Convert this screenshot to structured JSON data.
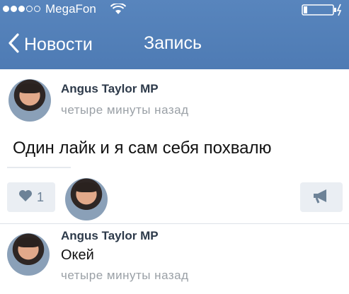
{
  "status_bar": {
    "carrier": "MegaFon",
    "signal_dots_filled": 3,
    "signal_dots_total": 5
  },
  "nav": {
    "back_label": "Новости",
    "title": "Запись"
  },
  "post": {
    "author": "Angus Taylor MP",
    "time": "четыре минуты назад",
    "text": "Один лайк и я сам себя похвалю",
    "likes_count": "1"
  },
  "comment": {
    "author": "Angus Taylor MP",
    "text": "Окей",
    "time": "четыре минуты назад"
  },
  "colors": {
    "header_blue": "#4e7bb4",
    "button_bg": "#eaeef3",
    "icon_gray": "#6d8297",
    "time_gray": "#9aa0a6"
  }
}
